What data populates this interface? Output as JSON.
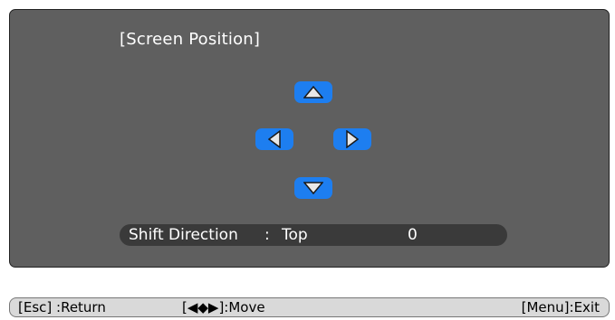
{
  "screen": {
    "title": "[Screen Position]"
  },
  "arrows": {
    "up_icon": "triangle-up",
    "left_icon": "triangle-left",
    "right_icon": "triangle-right",
    "down_icon": "triangle-down",
    "button_color": "#1d7ef0"
  },
  "shift": {
    "label": "Shift Direction",
    "separator": ":",
    "direction": "Top",
    "value": "0"
  },
  "help": {
    "esc": "[Esc] :Return",
    "move": "[◀◆▶]:Move",
    "menu": "[Menu]:Exit"
  },
  "colors": {
    "panel_bg": "#5f5f5f",
    "shift_bar_bg": "#3a3a3a",
    "help_bar_bg": "#d9d9d9"
  }
}
